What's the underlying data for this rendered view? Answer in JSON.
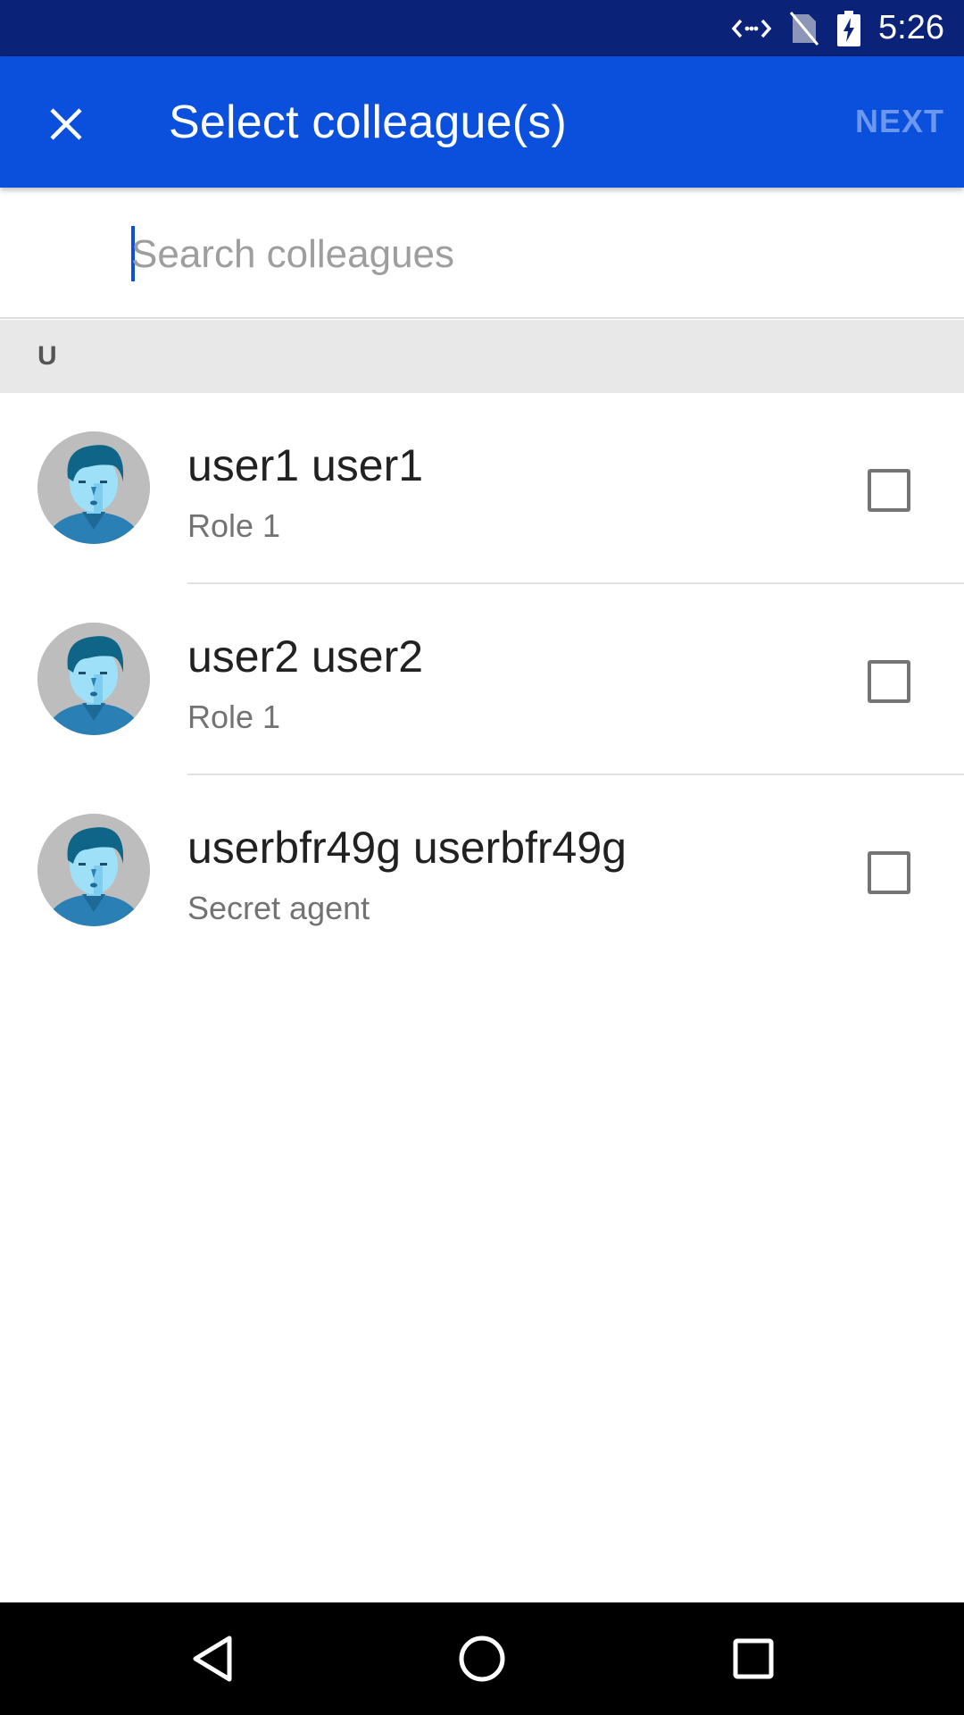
{
  "status_bar": {
    "time": "5:26",
    "icons": [
      "data-transfer-icon",
      "no-sim-icon",
      "battery-charging-icon"
    ]
  },
  "app_bar": {
    "title": "Select colleague(s)",
    "close_icon": "close-icon",
    "next_label": "NEXT"
  },
  "search": {
    "placeholder": "Search colleagues",
    "value": ""
  },
  "section": {
    "letter": "U"
  },
  "colleagues": [
    {
      "name": "user1 user1",
      "role": "Role 1",
      "checked": false
    },
    {
      "name": "user2 user2",
      "role": "Role 1",
      "checked": false
    },
    {
      "name": "userbfr49g userbfr49g",
      "role": "Secret agent",
      "checked": false
    }
  ],
  "nav_bar": {
    "icons": [
      "back-icon",
      "home-icon",
      "recents-icon"
    ]
  },
  "colors": {
    "status_bar": "#0a2277",
    "app_bar": "#0b50dc",
    "next_disabled": "#6b97ee",
    "section_bg": "#e8e8e8"
  }
}
